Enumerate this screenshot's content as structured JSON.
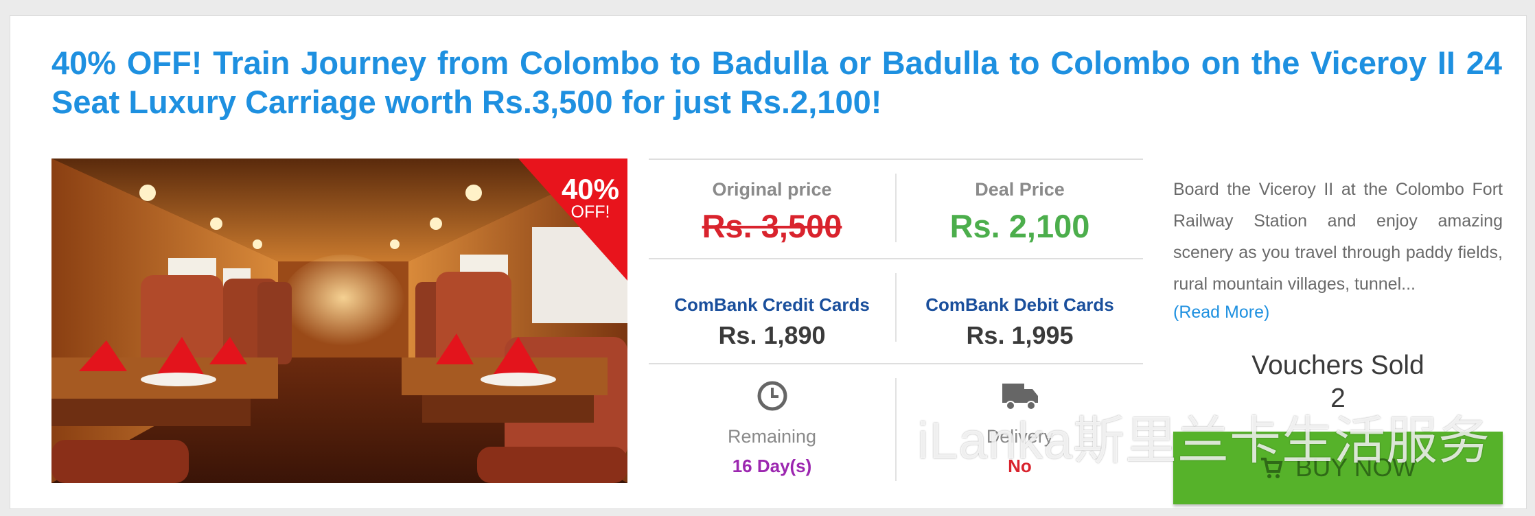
{
  "deal": {
    "title": "40% OFF! Train Journey from Colombo to Badulla or Badulla to Colombo on the Viceroy II 24 Seat Luxury Carriage worth Rs.3,500 for just Rs.2,100!",
    "image_alt": "Viceroy II luxury carriage interior",
    "discount_badge": {
      "percent": "40%",
      "label": "OFF!"
    }
  },
  "pricing": {
    "original": {
      "label": "Original price",
      "value": "Rs. 3,500"
    },
    "deal": {
      "label": "Deal Price",
      "value": "Rs. 2,100"
    },
    "credit": {
      "label": "ComBank Credit Cards",
      "value": "Rs. 1,890"
    },
    "debit": {
      "label": "ComBank Debit Cards",
      "value": "Rs. 1,995"
    },
    "remaining": {
      "label": "Remaining",
      "value": "16 Day(s)"
    },
    "delivery": {
      "label": "Delivery",
      "value": "No"
    }
  },
  "description": {
    "text": "Board the Viceroy II at the Colombo Fort Railway Station and enjoy amazing scenery as you travel through paddy fields, rural mountain villages, tunnel...",
    "read_more": "(Read More)"
  },
  "vouchers": {
    "label": "Vouchers Sold",
    "count": "2"
  },
  "buy_button": {
    "label": "BUY NOW"
  },
  "watermark": {
    "text": "iLanka斯里兰卡生活服务"
  },
  "colors": {
    "title": "#1e90e0",
    "strike": "#d9232d",
    "deal_price": "#4cae4c",
    "bank": "#1a4f9c",
    "remaining": "#9c27b0",
    "buy": "#56b22a",
    "ribbon": "#e8141c"
  },
  "icons": [
    "clock-icon",
    "truck-icon",
    "cart-icon",
    "wechat-icon"
  ]
}
